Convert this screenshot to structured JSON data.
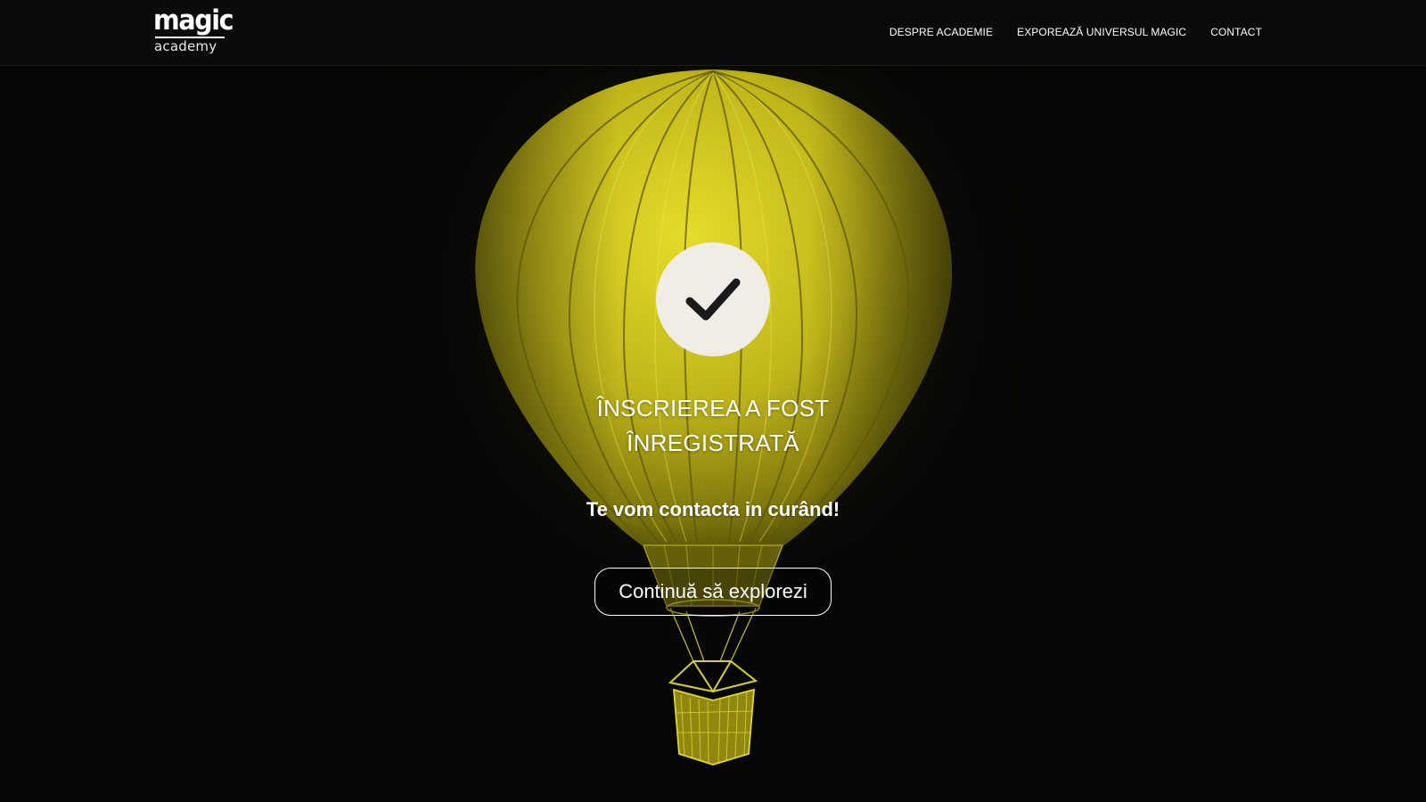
{
  "header": {
    "logo": {
      "top_text": "magic",
      "bottom_text": "academy"
    },
    "nav": [
      {
        "label": "DESPRE ACADEMIE"
      },
      {
        "label": "EXPOREAZĂ UNIVERSUL MAGIC"
      },
      {
        "label": "CONTACT"
      }
    ]
  },
  "main": {
    "icon": "checkmark-icon",
    "title_line1": "ÎNSCRIEREA A FOST",
    "title_line2": "ÎNREGISTRATĂ",
    "subtitle": "Te vom contacta in curând!",
    "cta_label": "Continuă să explorezi"
  },
  "colors": {
    "background": "#060606",
    "balloon": "#c9bf1c",
    "text": "#ffffff",
    "check_circle": "#efede6",
    "check_mark": "#1a1a1a"
  }
}
